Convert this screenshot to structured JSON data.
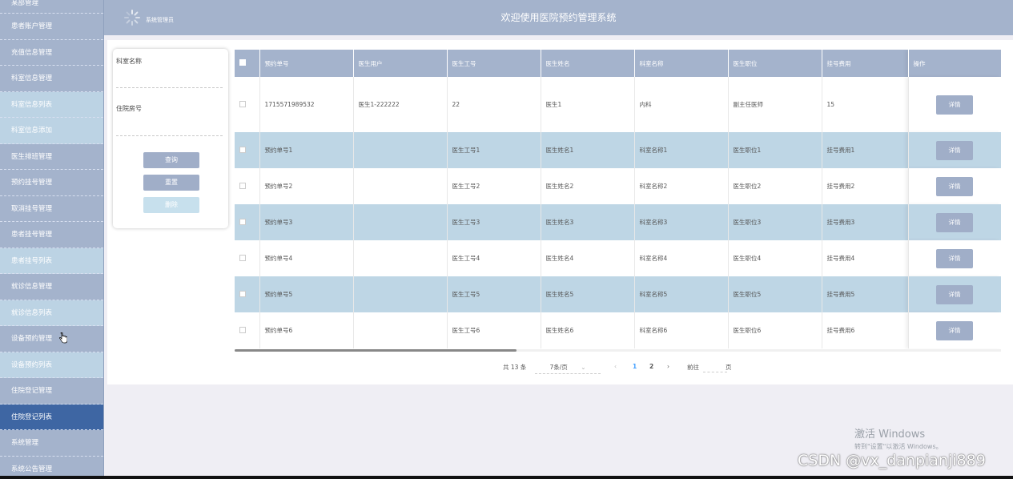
{
  "header": {
    "user_role": "系统管理员",
    "title": "欢迎使用医院预约管理系统"
  },
  "sidebar": {
    "items": [
      {
        "label": "某部管理",
        "type": "top"
      },
      {
        "label": "患者账户管理",
        "type": "group"
      },
      {
        "label": "充值信息管理",
        "type": "group"
      },
      {
        "label": "科室信息管理",
        "type": "group"
      },
      {
        "label": "科室信息列表",
        "type": "sub"
      },
      {
        "label": "科室信息添加",
        "type": "sub"
      },
      {
        "label": "医生排班管理",
        "type": "group"
      },
      {
        "label": "预约挂号管理",
        "type": "group"
      },
      {
        "label": "取消挂号管理",
        "type": "group"
      },
      {
        "label": "患者挂号管理",
        "type": "group"
      },
      {
        "label": "患者挂号列表",
        "type": "sub"
      },
      {
        "label": "就诊信息管理",
        "type": "group"
      },
      {
        "label": "就诊信息列表",
        "type": "sub"
      },
      {
        "label": "设备预约管理",
        "type": "group"
      },
      {
        "label": "设备预约列表",
        "type": "sub"
      },
      {
        "label": "住院登记管理",
        "type": "group"
      },
      {
        "label": "住院登记列表",
        "type": "active"
      },
      {
        "label": "系统管理",
        "type": "group"
      },
      {
        "label": "系统公告管理",
        "type": "group"
      }
    ]
  },
  "search": {
    "dept_label": "科室名称",
    "ward_label": "住院房号",
    "query_label": "查询",
    "reset_label": "重置",
    "delete_label": "删除"
  },
  "table": {
    "headers": [
      "预约单号",
      "医生用户",
      "医生工号",
      "医生姓名",
      "科室名称",
      "医生职位",
      "挂号费用",
      "操作"
    ],
    "detail_label": "详情",
    "rows": [
      [
        "1715571989532",
        "医生1-222222",
        "22",
        "医生1",
        "内科",
        "副主任医师",
        "15"
      ],
      [
        "预约单号1",
        "",
        "医生工号1",
        "医生姓名1",
        "科室名称1",
        "医生职位1",
        "挂号费用1"
      ],
      [
        "预约单号2",
        "",
        "医生工号2",
        "医生姓名2",
        "科室名称2",
        "医生职位2",
        "挂号费用2"
      ],
      [
        "预约单号3",
        "",
        "医生工号3",
        "医生姓名3",
        "科室名称3",
        "医生职位3",
        "挂号费用3"
      ],
      [
        "预约单号4",
        "",
        "医生工号4",
        "医生姓名4",
        "科室名称4",
        "医生职位4",
        "挂号费用4"
      ],
      [
        "预约单号5",
        "",
        "医生工号5",
        "医生姓名5",
        "科室名称5",
        "医生职位5",
        "挂号费用5"
      ],
      [
        "预约单号6",
        "",
        "医生工号6",
        "医生姓名6",
        "科室名称6",
        "医生职位6",
        "挂号费用6"
      ]
    ]
  },
  "pagination": {
    "total": "共 13 条",
    "page_size": "7条/页",
    "prev": "‹",
    "pages": [
      "1",
      "2"
    ],
    "active_page": "1",
    "next": "›",
    "goto_prefix": "前往",
    "goto_suffix": "页"
  },
  "watermark": {
    "windows_title": "激活 Windows",
    "windows_sub": "转到\"设置\"以激活 Windows。",
    "csdn": "CSDN @vx_danpianji889"
  },
  "colors": {
    "sidebar_bg": "#a4b3cc",
    "active_item": "#3e66a3",
    "sub_item": "#bcd3e4",
    "stripe_row": "#bed6e5",
    "button": "#a0aec8",
    "page_active": "#409eff"
  }
}
